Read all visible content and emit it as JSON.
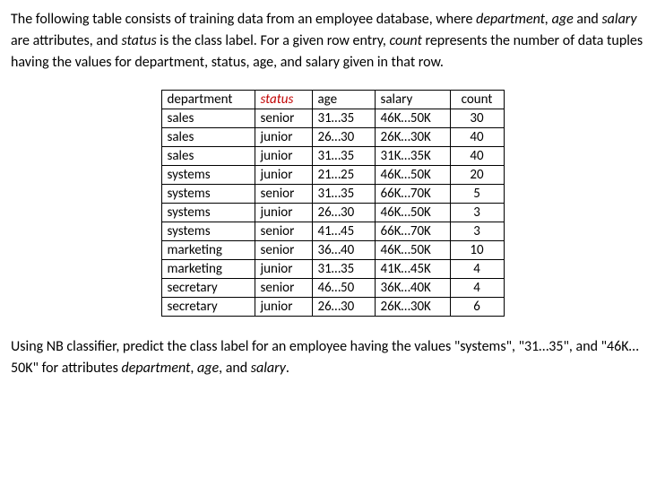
{
  "intro": {
    "text_a": "The following table consists of training data from an employee database, where ",
    "attr1": "department, age",
    "text_b": " and ",
    "attr2": "salary",
    "text_c": " are attributes, and ",
    "attr3": "status",
    "text_d": " is the class label. For a given row entry, ",
    "attr4": "count",
    "text_e": " represents the number of data tuples having the values for department, status, age, and salary given in that row."
  },
  "headers": {
    "department": "department",
    "status": "status",
    "age": "age",
    "salary": "salary",
    "count": "count"
  },
  "rows": [
    {
      "department": "sales",
      "status": "senior",
      "age": "31…35",
      "salary": "46K…50K",
      "count": "30"
    },
    {
      "department": "sales",
      "status": "junior",
      "age": "26…30",
      "salary": "26K…30K",
      "count": "40"
    },
    {
      "department": "sales",
      "status": "junior",
      "age": "31…35",
      "salary": "31K…35K",
      "count": "40"
    },
    {
      "department": "systems",
      "status": "junior",
      "age": "21…25",
      "salary": "46K…50K",
      "count": "20"
    },
    {
      "department": "systems",
      "status": "senior",
      "age": "31…35",
      "salary": "66K…70K",
      "count": "5"
    },
    {
      "department": "systems",
      "status": "junior",
      "age": "26…30",
      "salary": "46K…50K",
      "count": "3"
    },
    {
      "department": "systems",
      "status": "senior",
      "age": "41…45",
      "salary": "66K…70K",
      "count": "3"
    },
    {
      "department": "marketing",
      "status": "senior",
      "age": "36…40",
      "salary": "46K…50K",
      "count": "10"
    },
    {
      "department": "marketing",
      "status": "junior",
      "age": "31…35",
      "salary": "41K…45K",
      "count": "4"
    },
    {
      "department": "secretary",
      "status": "senior",
      "age": "46…50",
      "salary": "36K…40K",
      "count": "4"
    },
    {
      "department": "secretary",
      "status": "junior",
      "age": "26…30",
      "salary": "26K…30K",
      "count": "6"
    }
  ],
  "question": {
    "text_a": "Using NB classifier, predict the class label for an employee having the values \"systems\", \"31…35\", and \"46K…50K\" for attributes ",
    "attr1": "department",
    "text_b": ", ",
    "attr2": "age",
    "text_c": ", and ",
    "attr3": "salary",
    "text_d": "."
  }
}
